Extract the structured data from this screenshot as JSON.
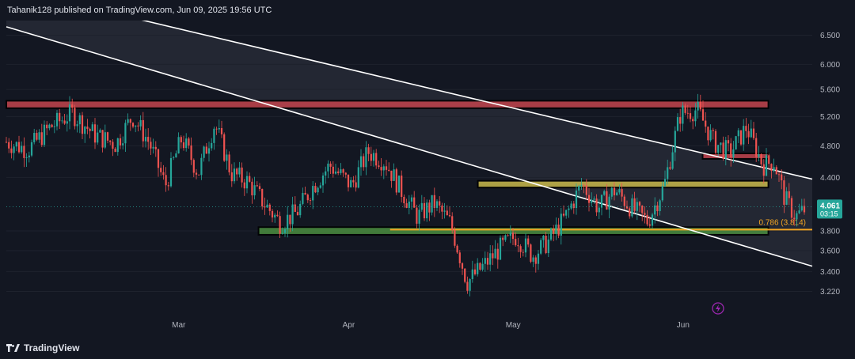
{
  "header": {
    "text": "Tahanik128 published on TradingView.com, Jun 09, 2025 19:56 UTC"
  },
  "footer": {
    "brand": "TradingView"
  },
  "colors": {
    "background": "#131722",
    "up": "#26a69a",
    "down": "#ef5350",
    "resistance_zone": "#c2444d",
    "mid_zone": "#c8b84a",
    "support_zone": "#4a8c3f",
    "fib_line": "#f5a623",
    "channel": "#ffffff",
    "last_price_bg": "#26a69a"
  },
  "chart_data": {
    "type": "candlestick",
    "title": "",
    "xlabel": "",
    "ylabel": "",
    "ylim": [
      3.12,
      6.62
    ],
    "y_scale": "log",
    "y_ticks": [
      "6.500",
      "6.000",
      "5.600",
      "5.200",
      "4.800",
      "4.400",
      "4.061",
      "3.800",
      "3.600",
      "3.400",
      "3.220"
    ],
    "x_ticks": [
      "Mar",
      "Apr",
      "May",
      "Jun"
    ],
    "last_price": {
      "value": "4.061",
      "countdown": "03:15"
    },
    "fib_level": {
      "label": "0.786 (3.814)",
      "value": 3.814
    },
    "zones": [
      {
        "name": "resistance",
        "from": 5.32,
        "to": 5.43
      },
      {
        "name": "upper-small",
        "from": 4.63,
        "to": 4.7
      },
      {
        "name": "middle",
        "from": 4.28,
        "to": 4.36
      },
      {
        "name": "support",
        "from": 3.76,
        "to": 3.84
      }
    ],
    "channel_lines": [
      {
        "name": "upper",
        "start": [
          "2025-02-01",
          7.4
        ],
        "end": [
          "2025-06-28",
          4.38
        ]
      },
      {
        "name": "lower",
        "start": [
          "2025-02-01",
          6.65
        ],
        "end": [
          "2025-06-28",
          3.45
        ]
      }
    ],
    "price_path": [
      [
        "2025-02-01",
        4.85
      ],
      [
        "2025-02-05",
        4.75
      ],
      [
        "2025-02-09",
        5.05
      ],
      [
        "2025-02-13",
        5.25
      ],
      [
        "2025-02-17",
        4.95
      ],
      [
        "2025-02-21",
        4.82
      ],
      [
        "2025-02-24",
        5.2
      ],
      [
        "2025-02-27",
        4.85
      ],
      [
        "2025-03-02",
        4.3
      ],
      [
        "2025-03-05",
        4.9
      ],
      [
        "2025-03-08",
        4.45
      ],
      [
        "2025-03-11",
        5.1
      ],
      [
        "2025-03-14",
        4.45
      ],
      [
        "2025-03-17",
        4.35
      ],
      [
        "2025-03-20",
        4.1
      ],
      [
        "2025-03-23",
        3.88
      ],
      [
        "2025-03-26",
        4.0
      ],
      [
        "2025-03-29",
        4.3
      ],
      [
        "2025-04-01",
        4.55
      ],
      [
        "2025-04-05",
        4.3
      ],
      [
        "2025-04-08",
        4.72
      ],
      [
        "2025-04-11",
        4.6
      ],
      [
        "2025-04-14",
        4.25
      ],
      [
        "2025-04-17",
        3.95
      ],
      [
        "2025-04-20",
        4.1
      ],
      [
        "2025-04-23",
        3.88
      ],
      [
        "2025-04-26",
        3.3
      ],
      [
        "2025-04-29",
        3.45
      ],
      [
        "2025-05-02",
        3.62
      ],
      [
        "2025-05-05",
        3.75
      ],
      [
        "2025-05-08",
        3.55
      ],
      [
        "2025-05-11",
        3.7
      ],
      [
        "2025-05-14",
        3.95
      ],
      [
        "2025-05-17",
        4.32
      ],
      [
        "2025-05-20",
        4.05
      ],
      [
        "2025-05-23",
        4.25
      ],
      [
        "2025-05-26",
        4.05
      ],
      [
        "2025-05-29",
        3.9
      ],
      [
        "2025-06-01",
        4.3
      ],
      [
        "2025-06-04",
        5.25
      ],
      [
        "2025-06-07",
        5.3
      ],
      [
        "2025-06-10",
        4.85
      ],
      [
        "2025-06-13",
        4.7
      ],
      [
        "2025-06-16",
        5.05
      ],
      [
        "2025-06-19",
        4.55
      ],
      [
        "2025-06-21",
        4.6
      ],
      [
        "2025-06-23",
        4.15
      ],
      [
        "2025-06-25",
        3.95
      ],
      [
        "2025-06-27",
        4.05
      ]
    ]
  }
}
